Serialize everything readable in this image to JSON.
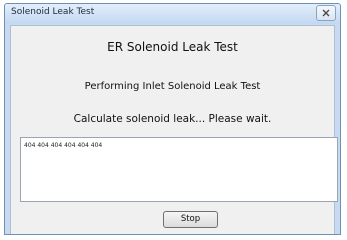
{
  "window": {
    "title": "Solenoid Leak Test"
  },
  "main": {
    "heading": "ER Solenoid Leak Test",
    "subheading": "Performing Inlet Solenoid Leak Test",
    "status": "Calculate solenoid leak... Please wait.",
    "log_text": "404 404 404 404 404 404"
  },
  "buttons": {
    "stop_label": "Stop"
  },
  "icons": {
    "close": "close-icon"
  },
  "colors": {
    "titlebar": "#c2d8f1",
    "client_background": "#f0f0f0"
  }
}
